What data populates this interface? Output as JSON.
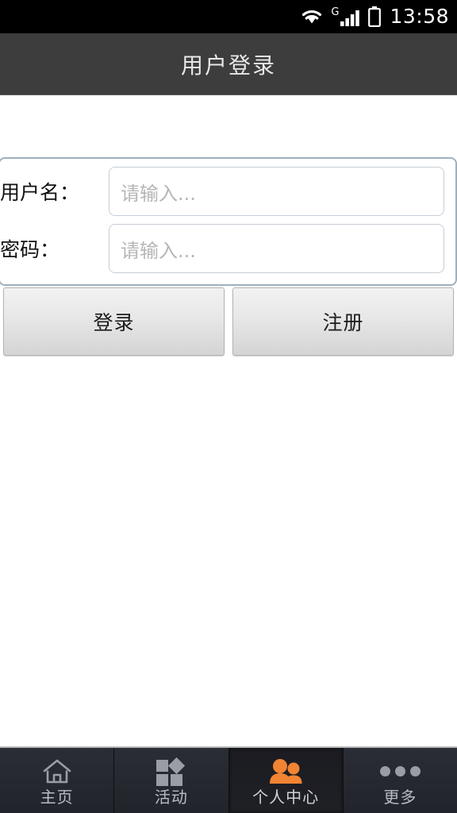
{
  "statusbar": {
    "time": "13:58",
    "wifi_icon": "wifi-icon",
    "signal_icon": "signal-bars-icon",
    "network_type": "G",
    "battery_icon": "battery-icon"
  },
  "titlebar": {
    "title": "用户登录"
  },
  "form": {
    "fields": [
      {
        "label": "用户名：",
        "value": "",
        "placeholder": "请输入..."
      },
      {
        "label": "密码：",
        "value": "",
        "placeholder": "请输入..."
      }
    ]
  },
  "actions": {
    "login_label": "登录",
    "register_label": "注册"
  },
  "bottomnav": {
    "active_index": 2,
    "active_color": "#f08432",
    "tabs": [
      {
        "label": "主页",
        "icon": "home-icon",
        "active": false
      },
      {
        "label": "活动",
        "icon": "grid-activity-icon",
        "active": false
      },
      {
        "label": "个人中心",
        "icon": "people-icon",
        "active": true
      },
      {
        "label": "更多",
        "icon": "more-dots-icon",
        "active": false
      }
    ]
  }
}
